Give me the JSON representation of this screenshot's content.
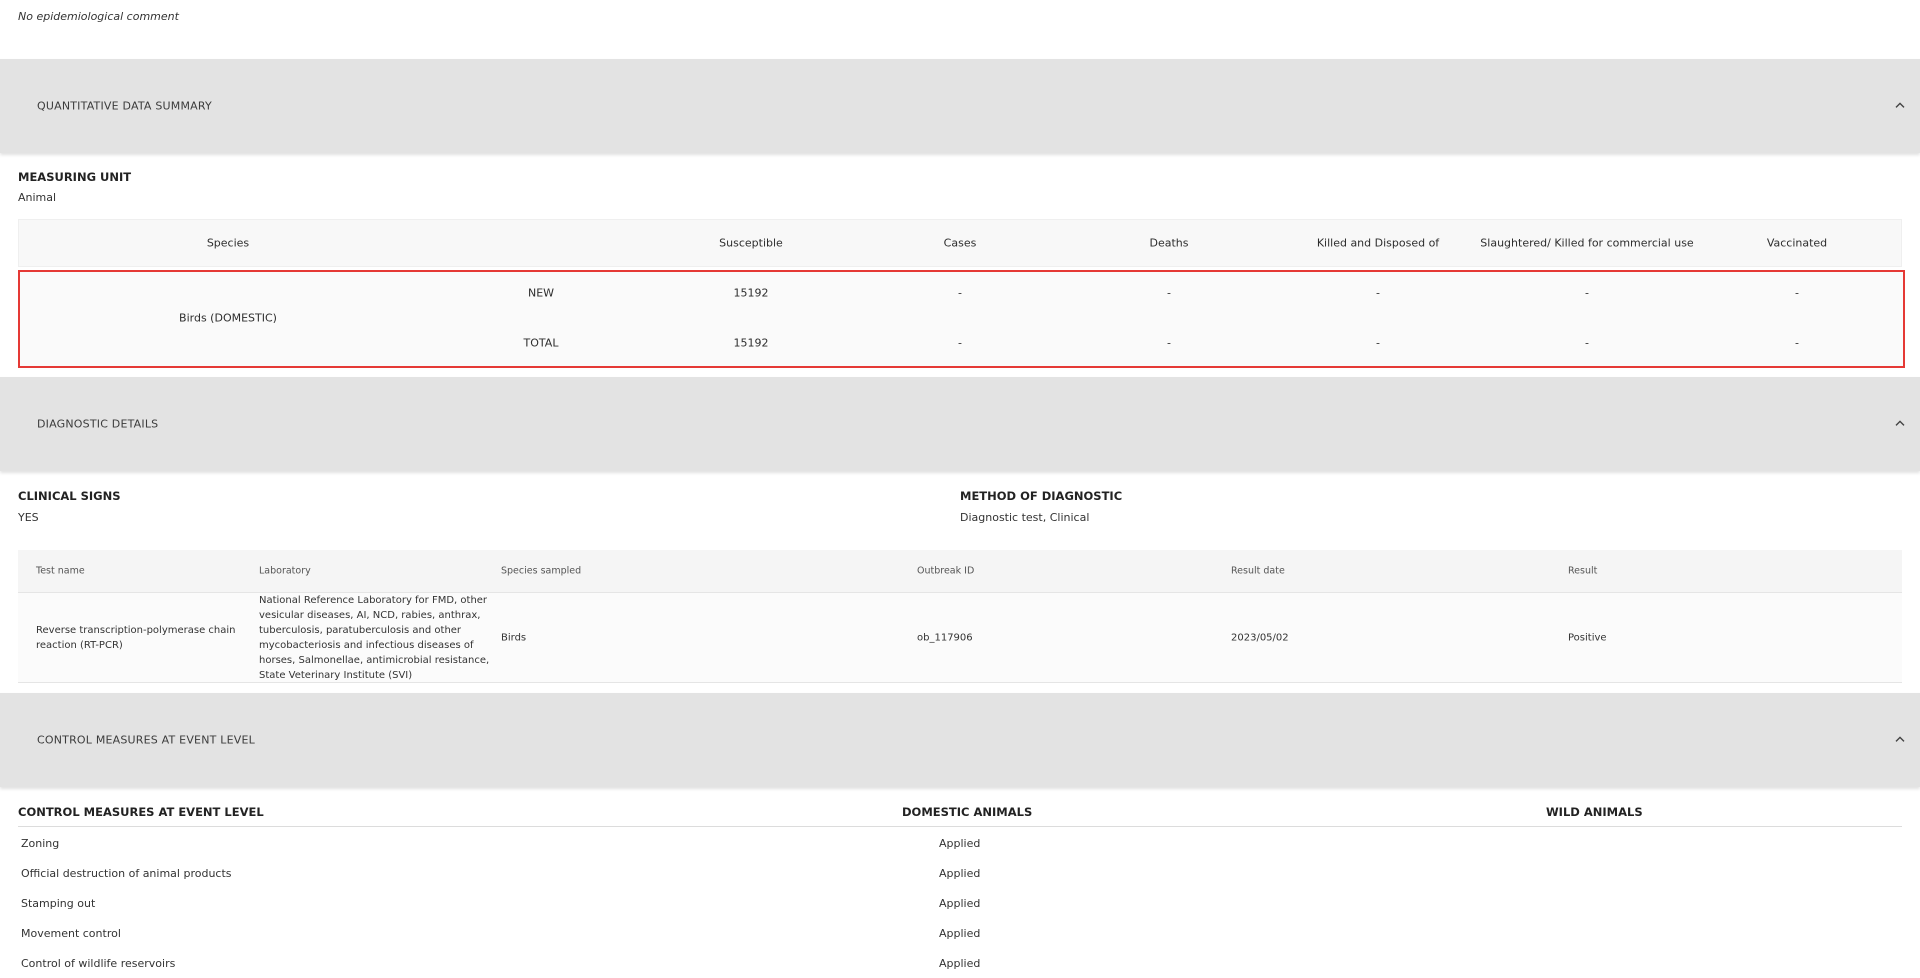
{
  "epi_comment": "No epidemiological comment",
  "sections": {
    "quantitative": "QUANTITATIVE DATA SUMMARY",
    "diagnostic": "DIAGNOSTIC DETAILS",
    "control": "CONTROL MEASURES AT EVENT LEVEL"
  },
  "measuring_unit": {
    "label": "MEASURING UNIT",
    "value": "Animal"
  },
  "quant_table": {
    "headers": [
      "Species",
      "Susceptible",
      "Cases",
      "Deaths",
      "Killed and Disposed of",
      "Slaughtered/ Killed for commercial use",
      "Vaccinated"
    ],
    "species": "Birds (DOMESTIC)",
    "rows": [
      {
        "type": "NEW",
        "values": [
          "15192",
          "-",
          "-",
          "-",
          "-",
          "-"
        ]
      },
      {
        "type": "TOTAL",
        "values": [
          "15192",
          "-",
          "-",
          "-",
          "-",
          "-"
        ]
      }
    ]
  },
  "clinical_signs": {
    "label": "CLINICAL SIGNS",
    "value": "YES"
  },
  "method_diagnostic": {
    "label": "METHOD OF DIAGNOSTIC",
    "value": "Diagnostic test, Clinical"
  },
  "diag_table": {
    "headers": [
      "Test name",
      "Laboratory",
      "Species sampled",
      "Outbreak ID",
      "Result date",
      "Result"
    ],
    "row": {
      "test": "Reverse transcription-polymerase chain reaction (RT-PCR)",
      "lab": "National Reference Laboratory for FMD, other vesicular diseases, AI, NCD, rabies, anthrax, tuberculosis, paratuberculosis and other mycobacteriosis and infectious diseases of horses, Salmonellae, antimicrobial resistance, State Veterinary Institute (SVI)",
      "species": "Birds",
      "outbreak": "ob_117906",
      "date": "2023/05/02",
      "result": "Positive"
    }
  },
  "control_measures": {
    "headers": [
      "CONTROL MEASURES AT EVENT LEVEL",
      "DOMESTIC ANIMALS",
      "WILD ANIMALS"
    ],
    "rows": [
      {
        "name": "Zoning",
        "domestic": "Applied"
      },
      {
        "name": "Official destruction of animal products",
        "domestic": "Applied"
      },
      {
        "name": "Stamping out",
        "domestic": "Applied"
      },
      {
        "name": "Movement control",
        "domestic": "Applied"
      },
      {
        "name": "Control of wildlife reservoirs",
        "domestic": "Applied"
      }
    ]
  },
  "icons": {
    "collapse": "chevron-up-icon"
  }
}
